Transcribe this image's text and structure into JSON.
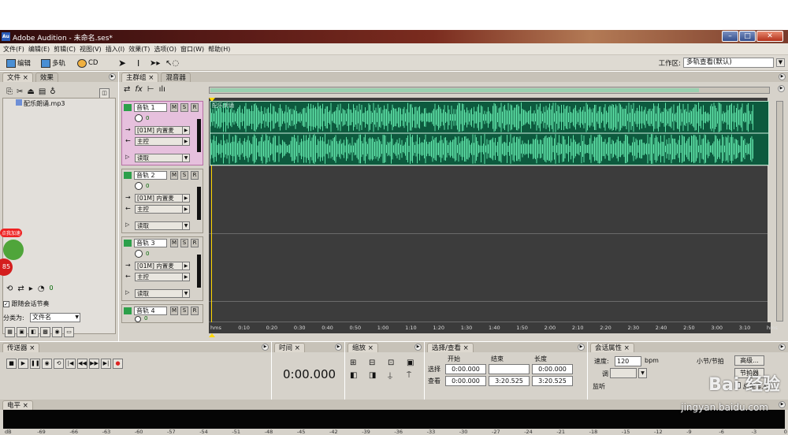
{
  "window": {
    "app_icon": "Au",
    "title": "Adobe Audition - 未命名.ses*"
  },
  "menu": [
    "文件(F)",
    "编辑(E)",
    "剪辑(C)",
    "视图(V)",
    "插入(I)",
    "效果(T)",
    "选项(O)",
    "窗口(W)",
    "帮助(H)"
  ],
  "toolbar": {
    "edit": "编辑",
    "multitrack": "多轨",
    "cd": "CD",
    "workspace_label": "工作区:",
    "workspace_value": "多轨查看(默认)"
  },
  "left_panel": {
    "tabs": [
      "文件",
      "效果"
    ],
    "file_item": "配乐朗诵.mp3",
    "follow_label": "跟随会话节奏",
    "sort_label": "分类为:",
    "sort_value": "文件名",
    "volume_value": "0"
  },
  "main_tabs": [
    "主群组",
    "混音器"
  ],
  "tracks": [
    {
      "name": "音轨 1",
      "vol": "0",
      "input": "[01M] 内置麦",
      "output": "主控",
      "mode": "读取"
    },
    {
      "name": "音轨 2",
      "vol": "0",
      "input": "[01M] 内置麦",
      "output": "主控",
      "mode": "读取"
    },
    {
      "name": "音轨 3",
      "vol": "0",
      "input": "[01M] 内置麦",
      "output": "主控",
      "mode": "读取"
    },
    {
      "name": "音轨 4",
      "vol": "0"
    }
  ],
  "clip_name": "配乐朗诵",
  "ruler": [
    "hms",
    "0:10",
    "0:20",
    "0:30",
    "0:40",
    "0:50",
    "1:00",
    "1:10",
    "1:20",
    "1:30",
    "1:40",
    "1:50",
    "2:00",
    "2:10",
    "2:20",
    "2:30",
    "2:40",
    "2:50",
    "3:00",
    "3:10",
    "hms"
  ],
  "transport": {
    "title": "传送器"
  },
  "time": {
    "title": "时间",
    "value": "0:00.000"
  },
  "zoom": {
    "title": "缩放"
  },
  "selection": {
    "title": "选择/查看",
    "col_start": "开始",
    "col_end": "结束",
    "col_length": "长度",
    "row_sel": "选择",
    "row_view": "查看",
    "sel_start": "0:00.000",
    "sel_end": "",
    "sel_length": "0:00.000",
    "view_start": "0:00.000",
    "view_end": "3:20.525",
    "view_length": "3:20.525"
  },
  "session": {
    "title": "会话属性",
    "tempo_label": "速度:",
    "tempo_value": "120",
    "bpm": "bpm",
    "bars_label": "小节/节拍",
    "advanced": "高级...",
    "key_label": "调",
    "monitor_label": "监听",
    "beats_label": "节拍器",
    "total_import": "总是导入"
  },
  "level": {
    "title": "电平",
    "ticks": [
      "dB",
      "-69",
      "-66",
      "-63",
      "-60",
      "-57",
      "-54",
      "-51",
      "-48",
      "-45",
      "-42",
      "-39",
      "-36",
      "-33",
      "-30",
      "-27",
      "-24",
      "-21",
      "-18",
      "-15",
      "-12",
      "-9",
      "-6",
      "-3",
      "0"
    ]
  },
  "watermark": {
    "logo": "Bai 经验",
    "url": "jingyan.baidu.com"
  },
  "sticker": {
    "text": "点我加速",
    "number": "85"
  }
}
